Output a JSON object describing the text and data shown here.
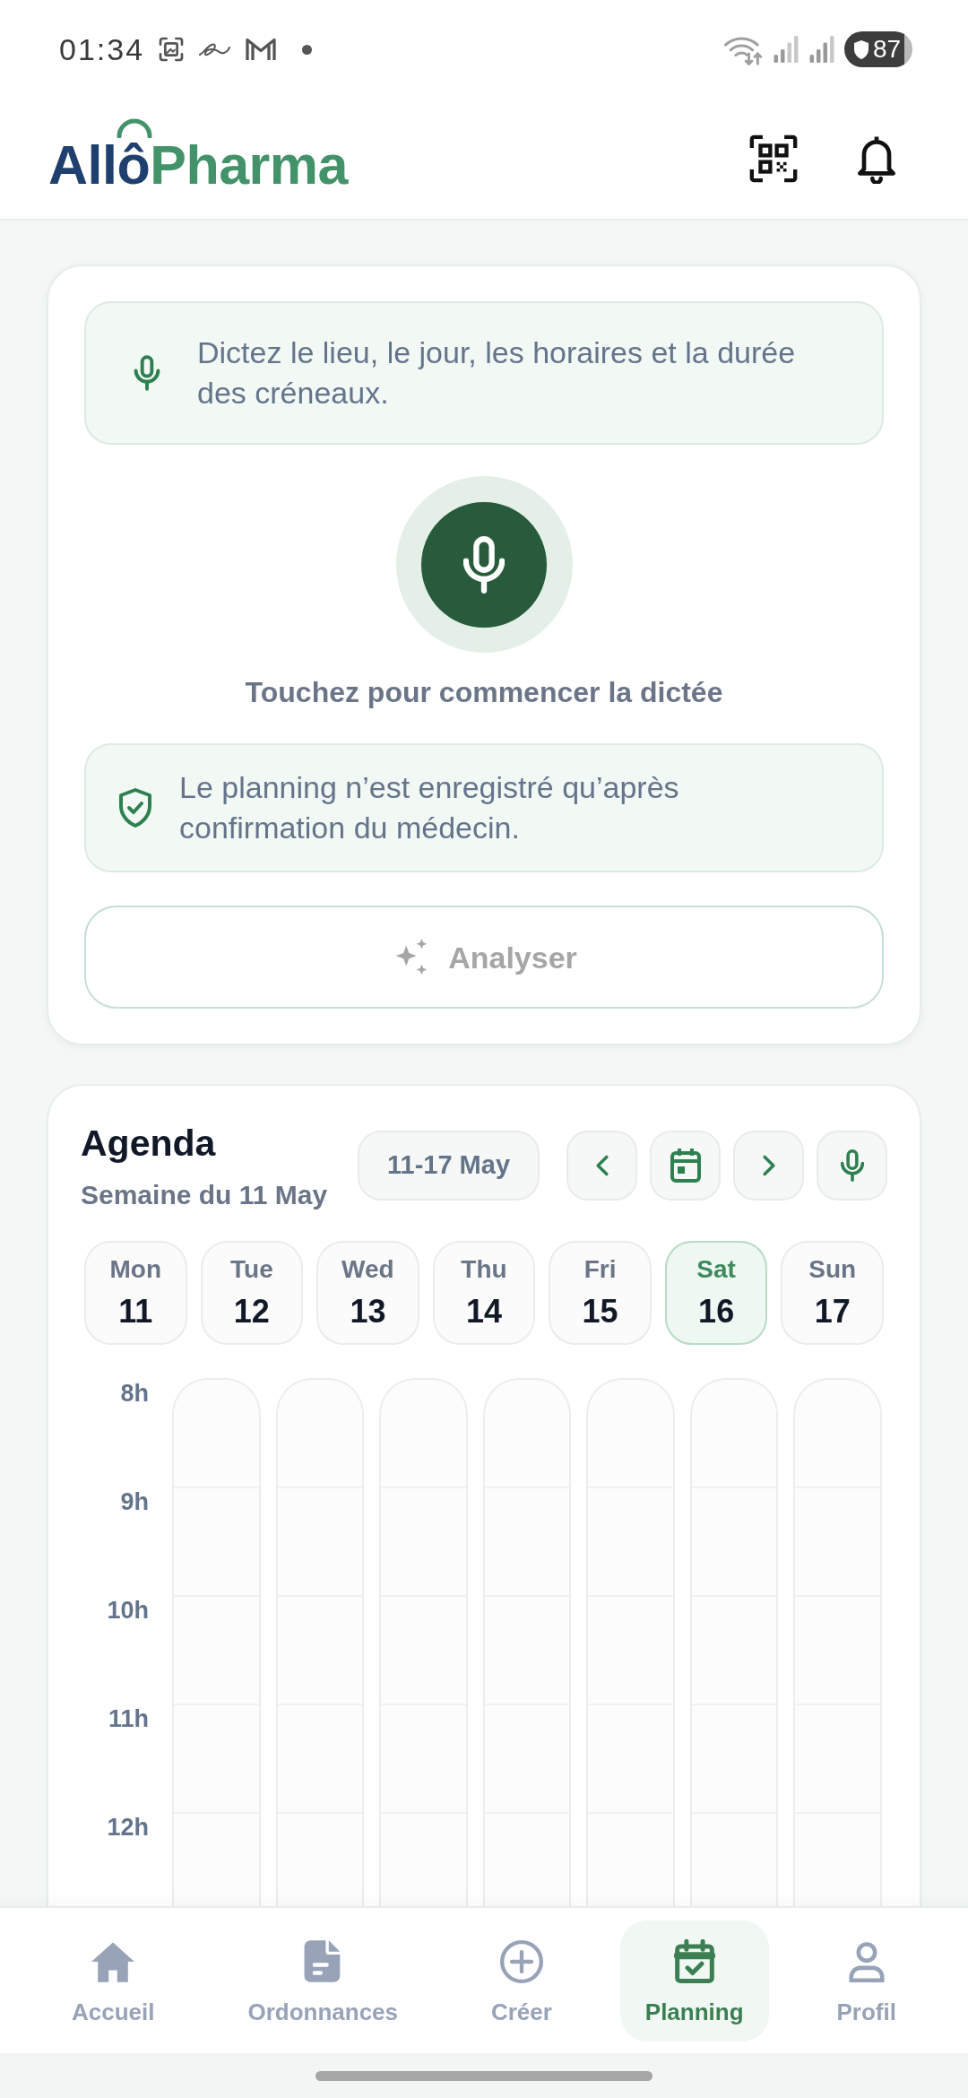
{
  "status_bar": {
    "time": "01:34",
    "battery": "87"
  },
  "header": {
    "logo": [
      "Allô",
      "Pharma"
    ]
  },
  "dictation": {
    "hint": "Dictez le lieu, le jour, les horaires et la durée des créneaux.",
    "prompt": "Touchez pour commencer la dictée",
    "notice": "Le planning n’est enregistré qu’après confirmation du médecin.",
    "analyse_button": {
      "label": "Analyser",
      "disabled": true
    }
  },
  "agenda": {
    "title": "Agenda",
    "subtitle": "Semaine du 11 May",
    "range": "11-17 May",
    "days": [
      {
        "name": "Mon",
        "date": "11",
        "selected": false
      },
      {
        "name": "Tue",
        "date": "12",
        "selected": false
      },
      {
        "name": "Wed",
        "date": "13",
        "selected": false
      },
      {
        "name": "Thu",
        "date": "14",
        "selected": false
      },
      {
        "name": "Fri",
        "date": "15",
        "selected": false
      },
      {
        "name": "Sat",
        "date": "16",
        "selected": true
      },
      {
        "name": "Sun",
        "date": "17",
        "selected": false
      }
    ],
    "hours": [
      "8h",
      "9h",
      "10h",
      "11h",
      "12h"
    ]
  },
  "bottom_nav": [
    {
      "label": "Accueil",
      "selected": false
    },
    {
      "label": "Ordonnances",
      "selected": false
    },
    {
      "label": "Créer",
      "selected": false
    },
    {
      "label": "Planning",
      "selected": true
    },
    {
      "label": "Profil",
      "selected": false
    }
  ]
}
